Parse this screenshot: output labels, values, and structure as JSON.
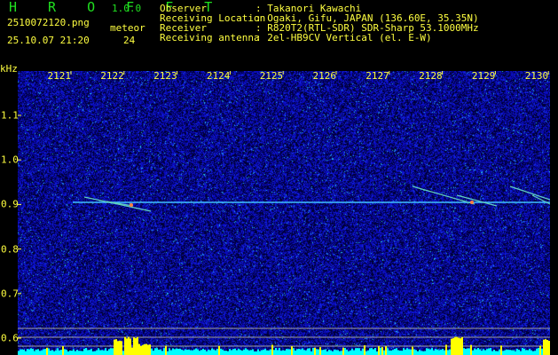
{
  "header": {
    "app_name": "H R O F F T",
    "version": "1.0.0",
    "filename": "2510072120.png",
    "datetime": "25.10.07 21:20",
    "meteor_label": "meteor",
    "meteor_count": "24"
  },
  "info": [
    {
      "label": "Observer",
      "value": "Takanori Kawachi"
    },
    {
      "label": "Receiving Location",
      "value": "Ogaki, Gifu, JAPAN (136.60E, 35.35N)"
    },
    {
      "label": "Receiver",
      "value": "R820T2(RTL-SDR) SDR-Sharp 53.1000MHz"
    },
    {
      "label": "Receiving antenna",
      "value": "2el-HB9CV Vertical (el. E-W)"
    }
  ],
  "axes": {
    "y_unit": "kHz",
    "y_ticks": [
      "1.1",
      "1.0",
      "0.9",
      "0.8",
      "0.7",
      "0.6"
    ],
    "x_ticks": [
      "2121",
      "2122",
      "2123",
      "2124",
      "2125",
      "2126",
      "2127",
      "2128",
      "2129",
      "2130"
    ]
  },
  "colors": {
    "text": "#ffff40",
    "title": "#20e020",
    "background": "#000000",
    "noise": "#1010a0",
    "trace": "#40c0ff",
    "level": "#00ffff",
    "peak": "#ffff00"
  }
}
